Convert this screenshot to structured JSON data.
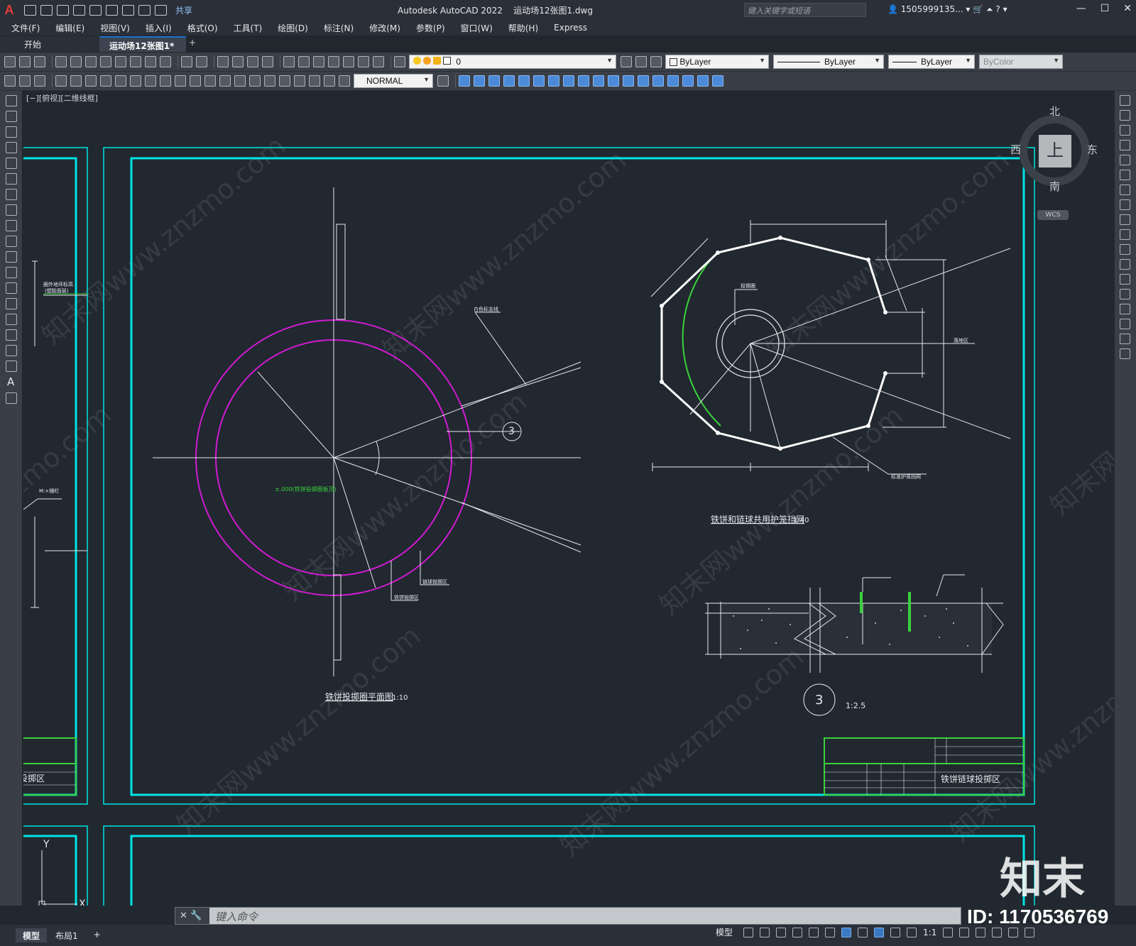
{
  "app": {
    "logo": "A",
    "title": "Autodesk AutoCAD 2022",
    "filename": "运动场12张图1.dwg",
    "share": "共享"
  },
  "search": {
    "placeholder": "键入关键字或短语"
  },
  "user": {
    "name": "1505999135..."
  },
  "menu": [
    "文件(F)",
    "编辑(E)",
    "视图(V)",
    "插入(I)",
    "格式(O)",
    "工具(T)",
    "绘图(D)",
    "标注(N)",
    "修改(M)",
    "参数(P)",
    "窗口(W)",
    "帮助(H)",
    "Express"
  ],
  "tabs": {
    "home": "开始",
    "active": "运动场12张图1*",
    "plus": "+"
  },
  "toolbar": {
    "layer": "0",
    "color": "ByLayer",
    "linetype": "ByLayer",
    "lineweight": "ByLayer",
    "plotstyle": "ByColor",
    "dimstyle": "NORMAL"
  },
  "viewport": {
    "label": "[−][俯视][二维线框]"
  },
  "viewcube": {
    "north": "北",
    "south": "南",
    "east": "东",
    "west": "西",
    "top": "上",
    "wcs": "WCS"
  },
  "drawing": {
    "title_left": "铁饼投掷圈平面图",
    "scale_left": "1:10",
    "title_right": "铁饼和链球共用护笼挡网",
    "scale_right": "1:40",
    "detail_num": "3",
    "detail_scale": "1:2.5",
    "marker_num": "3",
    "label_white_line": "白色标志线",
    "label_hammer_area": "链球抛掷区",
    "label_discus_area": "铁饼抛掷区",
    "label_green": "±.000(铁饼投掷圈板顶)",
    "label_circle": "投掷圈",
    "label_fall_zone": "落地区",
    "label_fence": "标准护笼挡网",
    "titleblock_name": "铁饼链球投掷区",
    "left_titleblock_name": "投掷区",
    "left_label_a": "M:×栅栏",
    "left_label_b": "圈外地坪标高",
    "left_label_c": "(塑胶面层)"
  },
  "command": {
    "label": "✕  🔧",
    "placeholder": "键入命令"
  },
  "layouts": [
    "模型",
    "布局1",
    "+"
  ],
  "status": {
    "model": "模型",
    "scale": "1:1"
  },
  "watermark": {
    "logo": "知末",
    "id": "ID: 1170536769"
  }
}
